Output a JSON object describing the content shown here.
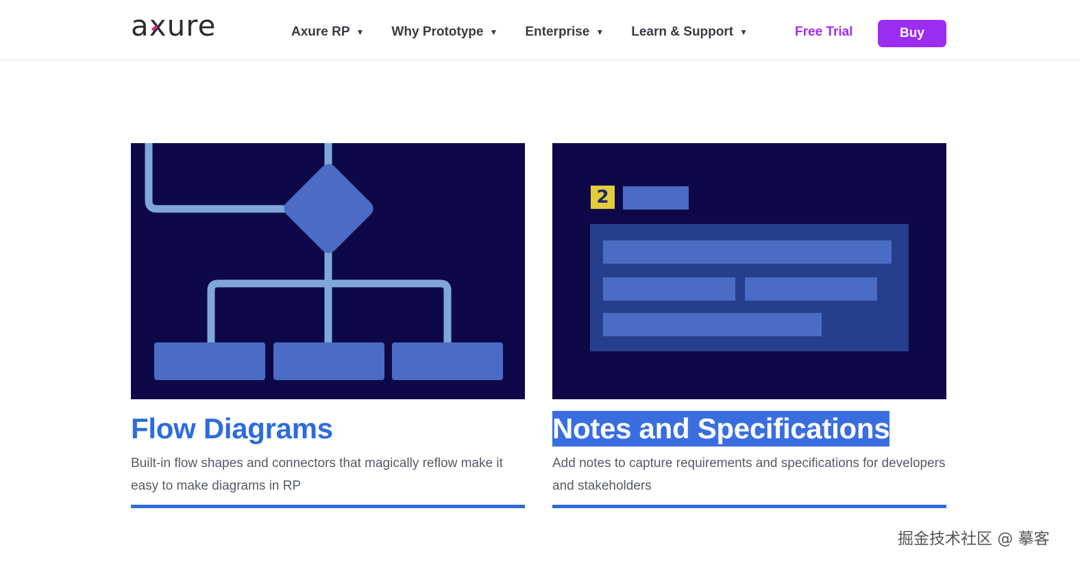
{
  "header": {
    "logo_text": "axure",
    "nav": [
      {
        "label": "Axure RP"
      },
      {
        "label": "Why Prototype"
      },
      {
        "label": "Enterprise"
      },
      {
        "label": "Learn & Support"
      }
    ],
    "free_trial_label": "Free Trial",
    "buy_label": "Buy",
    "accent_color": "#9b2df0"
  },
  "cards": [
    {
      "title": "Flow Diagrams",
      "description": "Built-in flow shapes and connectors that magically reflow make it easy to make diagrams in RP",
      "image_icon": "flow-diagram-illustration"
    },
    {
      "title": "Notes and Specifications",
      "description": "Add notes to capture requirements and specifications for developers and stakeholders",
      "image_icon": "notes-specifications-illustration",
      "badge_number": "2"
    }
  ],
  "colors": {
    "card_bg": "#0f0848",
    "shape_blue": "#4a6cc4",
    "connector": "#7fa8d8",
    "title_blue": "#2d6bdf",
    "badge_yellow": "#e3cd3a"
  },
  "watermark": "掘金技术社区 @ 摹客"
}
